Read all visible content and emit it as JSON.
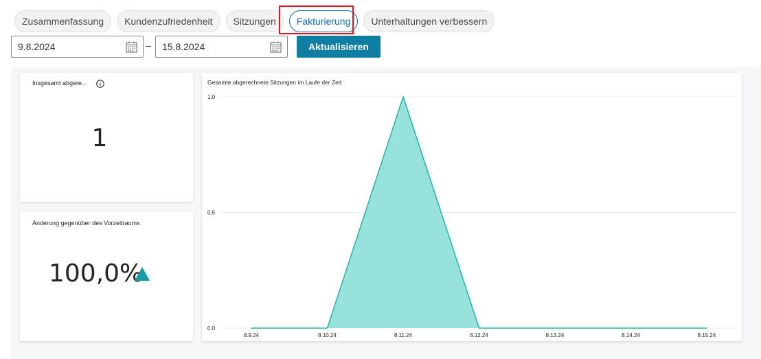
{
  "tabs": [
    {
      "label": "Zusammenfassung",
      "active": false
    },
    {
      "label": "Kundenzufriedenheit",
      "active": false
    },
    {
      "label": "Sitzungen",
      "active": false
    },
    {
      "label": "Fakturierung",
      "active": true
    },
    {
      "label": "Unterhaltungen verbessern",
      "active": false
    }
  ],
  "date_range": {
    "start": "9.8.2024",
    "separator": "–",
    "end": "15.8.2024"
  },
  "refresh_label": "Aktualisieren",
  "kpi_total": {
    "title": "Insgesamt abgere...",
    "value": "1"
  },
  "kpi_change": {
    "title": "Änderung gegenüber des Vorzeitraums",
    "value": "100,0%"
  },
  "colors": {
    "accent": "#0f7ea3",
    "tab_active": "#0f6cbd",
    "highlight": "#e0141e",
    "series_line": "#1fb5a6",
    "series_fill": "#97e2da",
    "trend_up": "#139aa3"
  },
  "chart_data": {
    "type": "area",
    "title": "Gesamte abgerechnete Sitzungen im Laufe der Zeit",
    "categories": [
      "8.9.24",
      "8.10.24",
      "8.11.24",
      "8.12.24",
      "8.13.24",
      "8.14.24",
      "8.15.24"
    ],
    "values": [
      0,
      0,
      1,
      0,
      0,
      0,
      0
    ],
    "y_ticks": [
      "0.0",
      "0.5",
      "1.0"
    ],
    "ylim": [
      0,
      1
    ],
    "grid": true
  }
}
